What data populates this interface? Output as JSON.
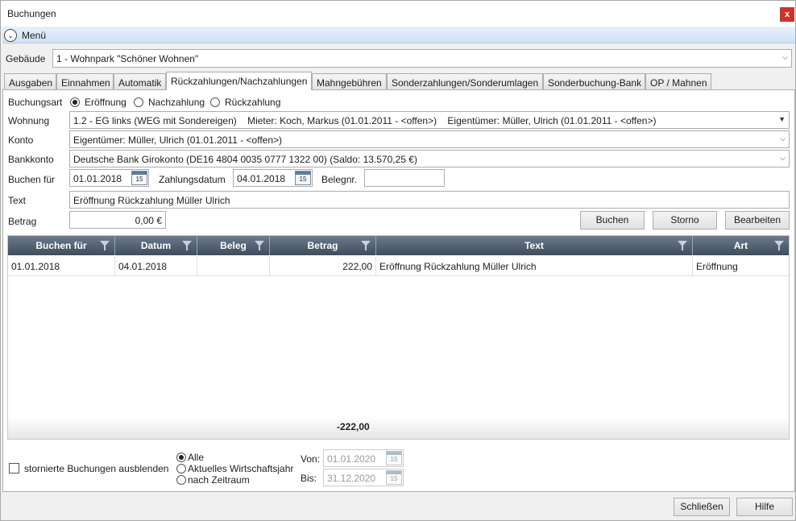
{
  "window": {
    "title": "Buchungen",
    "close": "x"
  },
  "menu": {
    "label": "Menü"
  },
  "gebaeude": {
    "label": "Gebäude",
    "value": "1 - Wohnpark \"Schöner Wohnen\""
  },
  "tabs": [
    "Ausgaben",
    "Einnahmen",
    "Automatik",
    "Rückzahlungen/Nachzahlungen",
    "Mahngebühren",
    "Sonderzahlungen/Sonderumlagen",
    "Sonderbuchung-Bank",
    "OP / Mahnen"
  ],
  "form": {
    "buchungsart_label": "Buchungsart",
    "radios": [
      "Eröffnung",
      "Nachzahlung",
      "Rückzahlung"
    ],
    "wohnung_label": "Wohnung",
    "wohnung_value": "1.2 - EG links (WEG mit Sondereigen)    Mieter: Koch, Markus (01.01.2011 - <offen>)    Eigentümer: Müller, Ulrich (01.01.2011 - <offen>)",
    "konto_label": "Konto",
    "konto_value": "Eigentümer: Müller, Ulrich (01.01.2011 - <offen>)",
    "bankkonto_label": "Bankkonto",
    "bankkonto_value": "Deutsche Bank Girokonto (DE16 4804 0035 0777 1322 00) (Saldo: 13.570,25 €)",
    "buchen_fuer_label": "Buchen für",
    "buchen_fuer_value": "01.01.2018",
    "zahlungsdatum_label": "Zahlungsdatum",
    "zahlungsdatum_value": "04.01.2018",
    "belegnr_label": "Belegnr.",
    "belegnr_value": "",
    "text_label": "Text",
    "text_value": "Eröffnung Rückzahlung Müller Ulrich",
    "betrag_label": "Betrag",
    "betrag_value": "0,00 €",
    "cal_day": "15",
    "buttons": {
      "buchen": "Buchen",
      "storno": "Storno",
      "bearbeiten": "Bearbeiten"
    }
  },
  "grid": {
    "columns": [
      "Buchen für",
      "Datum",
      "Beleg",
      "Betrag",
      "Text",
      "Art"
    ],
    "rows": [
      {
        "buchen_fuer": "01.01.2018",
        "datum": "04.01.2018",
        "beleg": "",
        "betrag": "222,00",
        "text": "Eröffnung Rückzahlung Müller Ulrich",
        "art": "Eröffnung"
      }
    ],
    "sum": "-222,00"
  },
  "filter": {
    "stornierte_label": "stornierte Buchungen ausblenden",
    "options": [
      "Alle",
      "Aktuelles Wirtschaftsjahr",
      "nach Zeitraum"
    ],
    "von_label": "Von:",
    "von_value": "01.01.2020",
    "bis_label": "Bis:",
    "bis_value": "31.12.2020"
  },
  "footer": {
    "schliessen": "Schließen",
    "hilfe": "Hilfe"
  }
}
